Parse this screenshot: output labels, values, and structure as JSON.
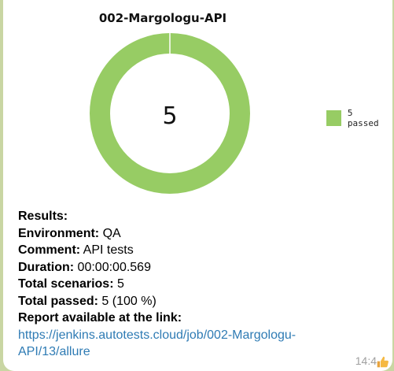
{
  "chart_data": {
    "type": "pie",
    "title": "002-Margologu-API",
    "center_label": "5",
    "categories": [
      "5 passed"
    ],
    "values": [
      5
    ],
    "colors": [
      "#97cc64"
    ]
  },
  "message": {
    "results_heading": "Results:",
    "fields": [
      {
        "label": "Environment:",
        "value": " QA"
      },
      {
        "label": "Comment:",
        "value": " API tests"
      },
      {
        "label": "Duration:",
        "value": " 00:00:00.569"
      },
      {
        "label": "Total scenarios:",
        "value": " 5"
      },
      {
        "label": "Total passed:",
        "value": " 5 (100 %)"
      }
    ],
    "report_label": "Report available at the link:",
    "report_link": "https://jenkins.autotests.cloud/job/002-Margologu-API/13/allure",
    "time": "14:4",
    "reaction_icon": "thumbs-up-icon"
  }
}
